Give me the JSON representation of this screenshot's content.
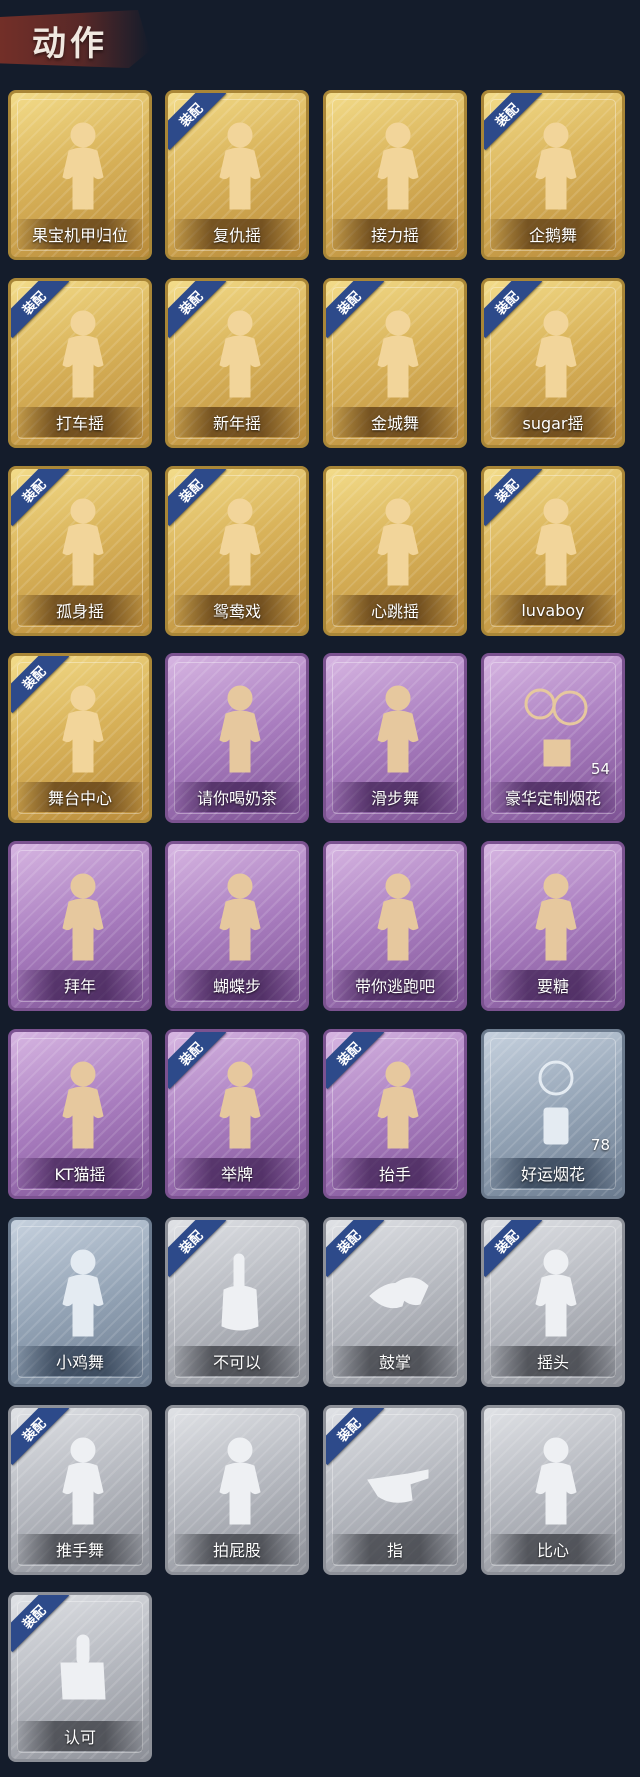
{
  "header": {
    "title": "动作"
  },
  "equipped_label": "装配",
  "colors": {
    "gold": "#d9b35a",
    "purple": "#a97dbf",
    "blue": "#94a4b6",
    "gray": "#b5b8bf",
    "ribbon": "#2d4a8a",
    "background": "#141c2b"
  },
  "cards": [
    {
      "label": "果宝机甲归位",
      "tier": "gold",
      "equipped": false,
      "icon": "emote-figure-icon"
    },
    {
      "label": "复仇摇",
      "tier": "gold",
      "equipped": true,
      "icon": "emote-figure-icon"
    },
    {
      "label": "接力摇",
      "tier": "gold",
      "equipped": false,
      "icon": "emote-figure-icon"
    },
    {
      "label": "企鹅舞",
      "tier": "gold",
      "equipped": true,
      "icon": "emote-figure-icon"
    },
    {
      "label": "打车摇",
      "tier": "gold",
      "equipped": true,
      "icon": "emote-figure-icon"
    },
    {
      "label": "新年摇",
      "tier": "gold",
      "equipped": true,
      "icon": "emote-figure-icon"
    },
    {
      "label": "金城舞",
      "tier": "gold",
      "equipped": true,
      "icon": "emote-figure-icon"
    },
    {
      "label": "sugar摇",
      "tier": "gold",
      "equipped": true,
      "icon": "emote-figure-icon"
    },
    {
      "label": "孤身摇",
      "tier": "gold",
      "equipped": true,
      "icon": "emote-figure-icon"
    },
    {
      "label": "鸳鸯戏",
      "tier": "gold",
      "equipped": true,
      "icon": "emote-figure-icon"
    },
    {
      "label": "心跳摇",
      "tier": "gold",
      "equipped": false,
      "icon": "emote-figure-icon"
    },
    {
      "label": "luvaboy",
      "tier": "gold",
      "equipped": true,
      "icon": "emote-figure-icon"
    },
    {
      "label": "舞台中心",
      "tier": "gold",
      "equipped": true,
      "icon": "emote-figure-icon"
    },
    {
      "label": "请你喝奶茶",
      "tier": "purple",
      "equipped": false,
      "icon": "emote-figure-icon"
    },
    {
      "label": "滑步舞",
      "tier": "purple",
      "equipped": false,
      "icon": "emote-figure-icon"
    },
    {
      "label": "豪华定制烟花",
      "tier": "purple",
      "equipped": false,
      "icon": "fireworks-icon",
      "count": "54"
    },
    {
      "label": "拜年",
      "tier": "purple",
      "equipped": false,
      "icon": "emote-figure-icon"
    },
    {
      "label": "蝴蝶步",
      "tier": "purple",
      "equipped": false,
      "icon": "emote-figure-icon"
    },
    {
      "label": "带你逃跑吧",
      "tier": "purple",
      "equipped": false,
      "icon": "emote-figure-icon"
    },
    {
      "label": "要糖",
      "tier": "purple",
      "equipped": false,
      "icon": "emote-figure-icon"
    },
    {
      "label": "KT猫摇",
      "tier": "purple",
      "equipped": false,
      "icon": "emote-figure-icon"
    },
    {
      "label": "举牌",
      "tier": "purple",
      "equipped": true,
      "icon": "emote-figure-icon"
    },
    {
      "label": "抬手",
      "tier": "purple",
      "equipped": true,
      "icon": "emote-figure-icon"
    },
    {
      "label": "好运烟花",
      "tier": "blue",
      "equipped": false,
      "icon": "firecracker-icon",
      "count": "78"
    },
    {
      "label": "小鸡舞",
      "tier": "blue",
      "equipped": false,
      "icon": "emote-figure-icon"
    },
    {
      "label": "不可以",
      "tier": "gray",
      "equipped": true,
      "icon": "finger-wag-icon"
    },
    {
      "label": "鼓掌",
      "tier": "gray",
      "equipped": true,
      "icon": "clapping-hands-icon"
    },
    {
      "label": "摇头",
      "tier": "gray",
      "equipped": true,
      "icon": "emote-figure-icon"
    },
    {
      "label": "推手舞",
      "tier": "gray",
      "equipped": true,
      "icon": "emote-figure-icon"
    },
    {
      "label": "拍屁股",
      "tier": "gray",
      "equipped": false,
      "icon": "emote-figure-icon"
    },
    {
      "label": "指",
      "tier": "gray",
      "equipped": true,
      "icon": "pointing-hand-icon"
    },
    {
      "label": "比心",
      "tier": "gray",
      "equipped": false,
      "icon": "emote-figure-icon"
    },
    {
      "label": "认可",
      "tier": "gray",
      "equipped": true,
      "icon": "thumbs-up-icon"
    }
  ]
}
